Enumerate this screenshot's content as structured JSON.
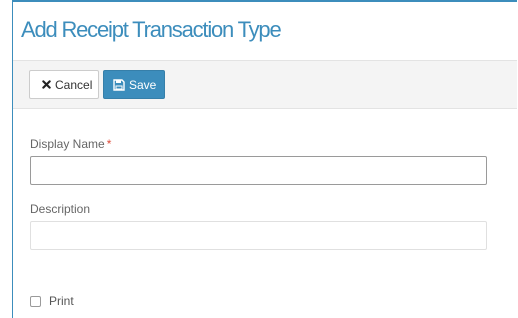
{
  "header": {
    "title": "Add Receipt Transaction Type"
  },
  "toolbar": {
    "cancel_label": "Cancel",
    "save_label": "Save"
  },
  "form": {
    "display_name": {
      "label": "Display Name",
      "required_marker": "*",
      "value": ""
    },
    "description": {
      "label": "Description",
      "value": ""
    },
    "print": {
      "label": "Print",
      "checked": false
    }
  },
  "colors": {
    "accent": "#3c8dbc",
    "required": "#dd4b39",
    "toolbar_bg": "#f4f4f4"
  },
  "icons": {
    "cancel": "close-icon",
    "save": "floppy-disk-icon"
  }
}
